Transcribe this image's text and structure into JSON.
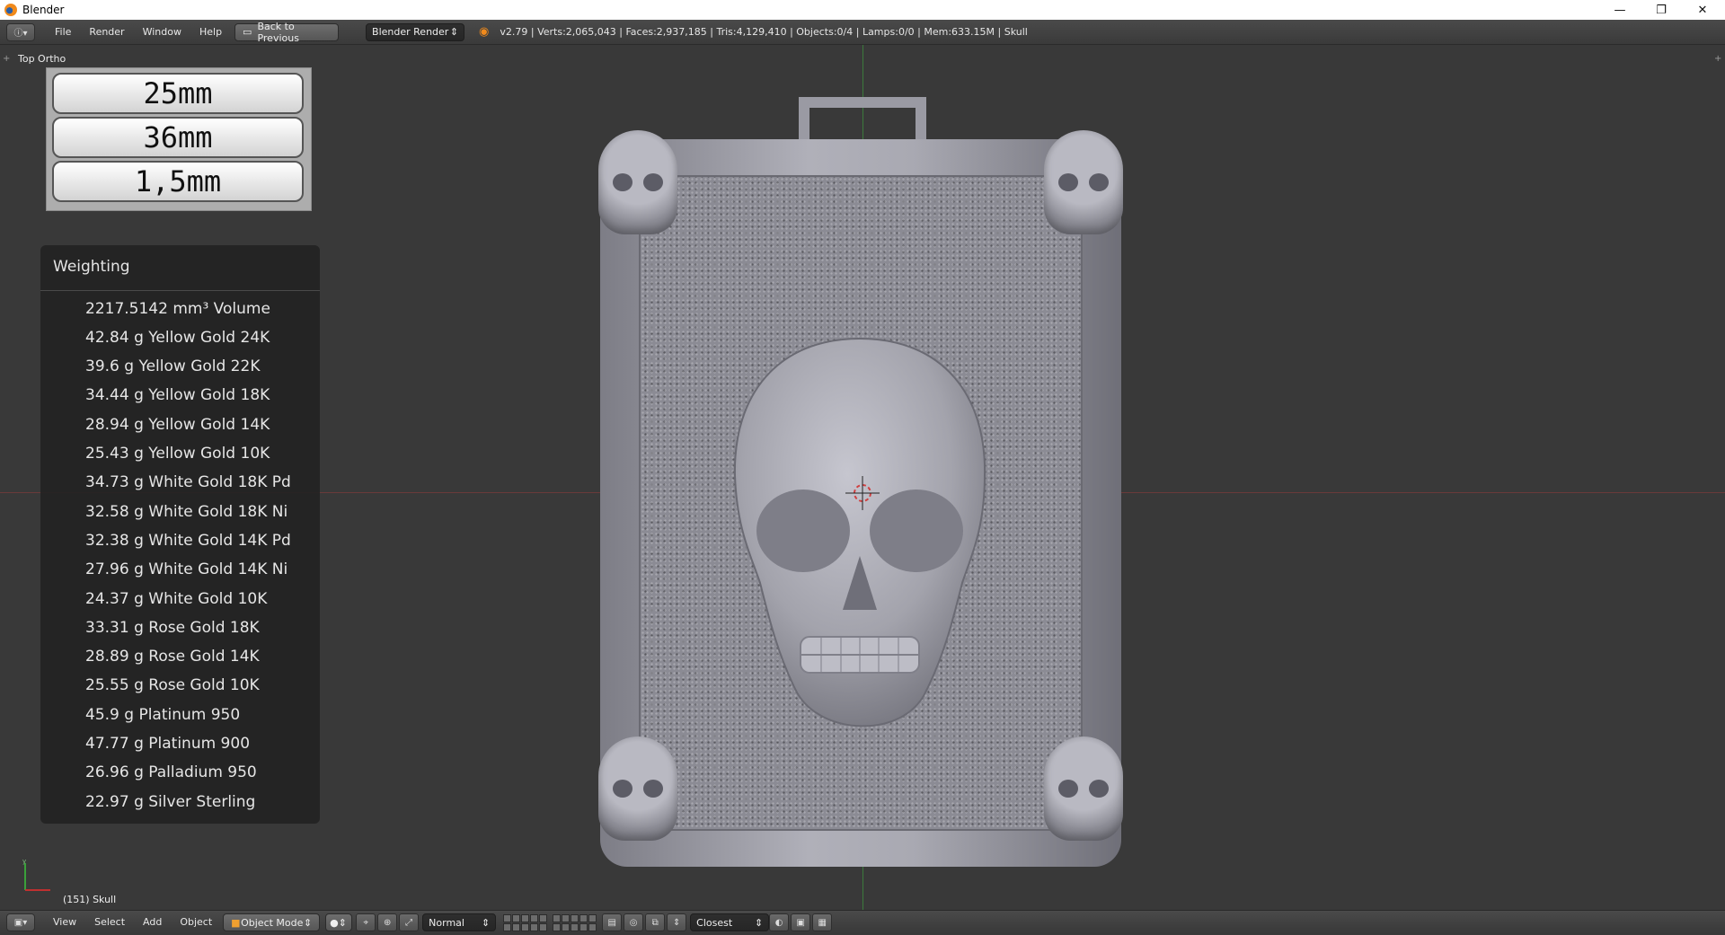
{
  "window": {
    "title": "Blender",
    "controls": {
      "minimize": "—",
      "restore": "❐",
      "close": "✕"
    }
  },
  "topbar": {
    "menus": [
      "File",
      "Render",
      "Window",
      "Help"
    ],
    "back_button": "Back to Previous",
    "render_engine": "Blender Render",
    "stats": "v2.79 | Verts:2,065,043 | Faces:2,937,185 | Tris:4,129,410 | Objects:0/4 | Lamps:0/0 | Mem:633.15M | Skull"
  },
  "viewport": {
    "view_label": "Top Ortho",
    "object_label": "(151) Skull",
    "dimensions": [
      "25mm",
      "36mm",
      "1,5mm"
    ]
  },
  "weighting": {
    "title": "Weighting",
    "rows": [
      "2217.5142 mm³ Volume",
      "42.84 g  Yellow Gold 24K",
      "39.6 g  Yellow Gold 22K",
      "34.44 g  Yellow Gold 18K",
      "28.94 g  Yellow Gold 14K",
      "25.43 g  Yellow Gold 10K",
      "34.73 g  White Gold 18K Pd",
      "32.58 g  White Gold 18K Ni",
      "32.38 g  White Gold 14K Pd",
      "27.96 g  White Gold 14K Ni",
      "24.37 g  White Gold 10K",
      "33.31 g  Rose Gold 18K",
      "28.89 g  Rose Gold 14K",
      "25.55 g  Rose Gold 10K",
      "45.9 g  Platinum 950",
      "47.77 g  Platinum 900",
      "26.96 g  Palladium 950",
      "22.97 g  Silver Sterling"
    ]
  },
  "bottombar": {
    "menus": [
      "View",
      "Select",
      "Add",
      "Object"
    ],
    "mode": "Object Mode",
    "orientation": "Normal",
    "snap_target": "Closest"
  },
  "colors": {
    "accent": "#5680c2",
    "background": "#393939",
    "model": "#a8a8b1"
  }
}
